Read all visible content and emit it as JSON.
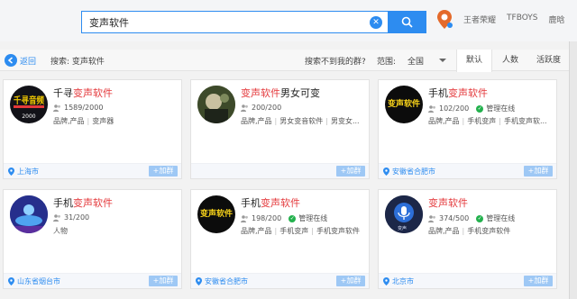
{
  "search": {
    "query": "变声软件",
    "clear_icon": "clear-icon",
    "button_icon": "search-icon"
  },
  "hot_links": [
    "王者荣耀",
    "TFBOYS",
    "鹿晗"
  ],
  "filter": {
    "back_label": "返回",
    "crumb": "搜索: 变声软件",
    "not_found": "搜索不到我的群?",
    "range_label": "范围:",
    "range_value": "全国",
    "sort_tabs": [
      "默认",
      "人数",
      "活跃度"
    ],
    "active_sort": "默认"
  },
  "join_label": "+加群",
  "cards": [
    {
      "title_prefix": "千寻",
      "title_highlight": "变声软件",
      "title_suffix": "",
      "members": "1589/2000",
      "verified": false,
      "verified_label": "",
      "tags": [
        "品牌,产品",
        "变声器"
      ],
      "location": "上海市"
    },
    {
      "title_prefix": "",
      "title_highlight": "变声软件",
      "title_suffix": "男女可变",
      "members": "200/200",
      "verified": false,
      "verified_label": "",
      "tags": [
        "品牌,产品",
        "男女变音软件",
        "男变女..."
      ],
      "location": ""
    },
    {
      "title_prefix": "手机",
      "title_highlight": "变声软件",
      "title_suffix": "",
      "members": "102/200",
      "verified": true,
      "verified_label": "管理在线",
      "tags": [
        "品牌,产品",
        "手机变声",
        "手机变声软..."
      ],
      "location": "安徽省合肥市"
    },
    {
      "title_prefix": "手机",
      "title_highlight": "变声软件",
      "title_suffix": "",
      "members": "31/200",
      "verified": false,
      "verified_label": "",
      "tags": [
        "人物"
      ],
      "location": "山东省烟台市"
    },
    {
      "title_prefix": "手机",
      "title_highlight": "变声软件",
      "title_suffix": "",
      "members": "198/200",
      "verified": true,
      "verified_label": "管理在线",
      "tags": [
        "品牌,产品",
        "手机变声",
        "手机变声软件"
      ],
      "location": "安徽省合肥市"
    },
    {
      "title_prefix": "",
      "title_highlight": "变声软件",
      "title_suffix": "",
      "members": "374/500",
      "verified": true,
      "verified_label": "管理在线",
      "tags": [
        "品牌,产品",
        "手机变声软件"
      ],
      "location": "北京市"
    }
  ],
  "avatar_texts": {
    "card1": "千寻音频",
    "card1_year": "2000",
    "card3": "变声软件",
    "card5": "变声软件",
    "card6": "变声"
  },
  "colors": {
    "accent": "#2d8cf0",
    "highlight": "#e4393c",
    "online": "#23b14d"
  }
}
